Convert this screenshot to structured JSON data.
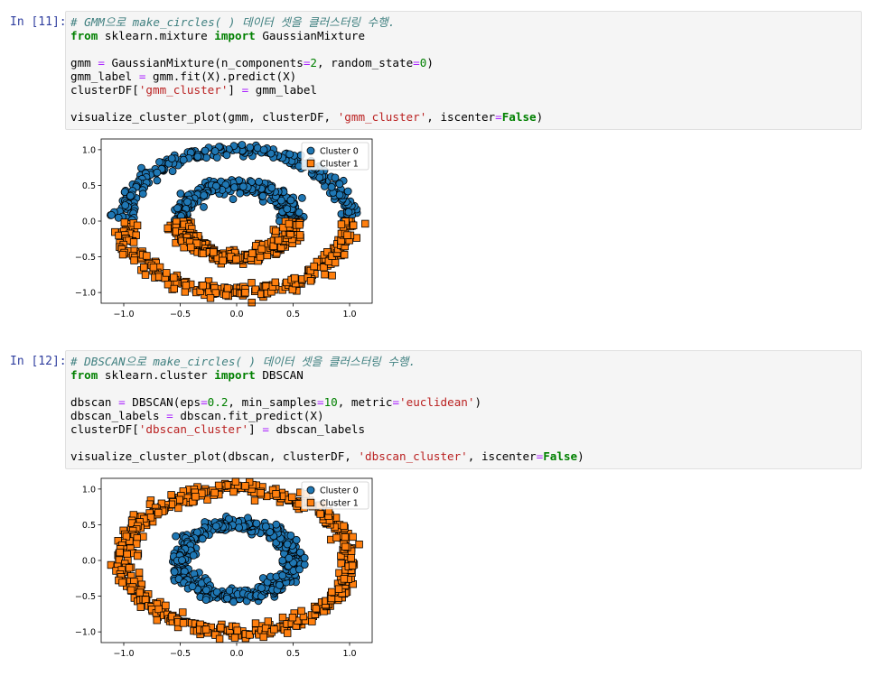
{
  "cells": [
    {
      "prompt": "In [11]:",
      "code": [
        [
          {
            "t": "# GMM으로 make_circles( ) 데이터 셋을 클러스터링 수행.",
            "c": "comment"
          }
        ],
        [
          {
            "t": "from",
            "c": "kw"
          },
          {
            "t": " sklearn.mixture ",
            "c": ""
          },
          {
            "t": "import",
            "c": "kw"
          },
          {
            "t": " GaussianMixture",
            "c": ""
          }
        ],
        [],
        [
          {
            "t": "gmm ",
            "c": ""
          },
          {
            "t": "=",
            "c": "op"
          },
          {
            "t": " GaussianMixture(n_components",
            "c": ""
          },
          {
            "t": "=",
            "c": "op"
          },
          {
            "t": "2",
            "c": "num"
          },
          {
            "t": ", random_state",
            "c": ""
          },
          {
            "t": "=",
            "c": "op"
          },
          {
            "t": "0",
            "c": "num"
          },
          {
            "t": ")",
            "c": ""
          }
        ],
        [
          {
            "t": "gmm_label ",
            "c": ""
          },
          {
            "t": "=",
            "c": "op"
          },
          {
            "t": " gmm.fit(X).predict(X)",
            "c": ""
          }
        ],
        [
          {
            "t": "clusterDF[",
            "c": ""
          },
          {
            "t": "'gmm_cluster'",
            "c": "str"
          },
          {
            "t": "] ",
            "c": ""
          },
          {
            "t": "=",
            "c": "op"
          },
          {
            "t": " gmm_label",
            "c": ""
          }
        ],
        [],
        [
          {
            "t": "visualize_cluster_plot(gmm, clusterDF, ",
            "c": ""
          },
          {
            "t": "'gmm_cluster'",
            "c": "str"
          },
          {
            "t": ", iscenter",
            "c": ""
          },
          {
            "t": "=",
            "c": "op"
          },
          {
            "t": "False",
            "c": "kw"
          },
          {
            "t": ")",
            "c": ""
          }
        ]
      ]
    },
    {
      "prompt": "In [12]:",
      "code": [
        [
          {
            "t": "# DBSCAN으로 make_circles( ) 데이터 셋을 클러스터링 수행.",
            "c": "comment"
          }
        ],
        [
          {
            "t": "from",
            "c": "kw"
          },
          {
            "t": " sklearn.cluster ",
            "c": ""
          },
          {
            "t": "import",
            "c": "kw"
          },
          {
            "t": " DBSCAN",
            "c": ""
          }
        ],
        [],
        [
          {
            "t": "dbscan ",
            "c": ""
          },
          {
            "t": "=",
            "c": "op"
          },
          {
            "t": " DBSCAN(eps",
            "c": ""
          },
          {
            "t": "=",
            "c": "op"
          },
          {
            "t": "0.2",
            "c": "num"
          },
          {
            "t": ", min_samples",
            "c": ""
          },
          {
            "t": "=",
            "c": "op"
          },
          {
            "t": "10",
            "c": "num"
          },
          {
            "t": ", metric",
            "c": ""
          },
          {
            "t": "=",
            "c": "op"
          },
          {
            "t": "'euclidean'",
            "c": "str"
          },
          {
            "t": ")",
            "c": ""
          }
        ],
        [
          {
            "t": "dbscan_labels ",
            "c": ""
          },
          {
            "t": "=",
            "c": "op"
          },
          {
            "t": " dbscan.fit_predict(X)",
            "c": ""
          }
        ],
        [
          {
            "t": "clusterDF[",
            "c": ""
          },
          {
            "t": "'dbscan_cluster'",
            "c": "str"
          },
          {
            "t": "] ",
            "c": ""
          },
          {
            "t": "=",
            "c": "op"
          },
          {
            "t": " dbscan_labels",
            "c": ""
          }
        ],
        [],
        [
          {
            "t": "visualize_cluster_plot(dbscan, clusterDF, ",
            "c": ""
          },
          {
            "t": "'dbscan_cluster'",
            "c": "str"
          },
          {
            "t": ", iscenter",
            "c": ""
          },
          {
            "t": "=",
            "c": "op"
          },
          {
            "t": "False",
            "c": "kw"
          },
          {
            "t": ")",
            "c": ""
          }
        ]
      ]
    }
  ],
  "chart_data": [
    {
      "type": "scatter",
      "xlim": [
        -1.2,
        1.2
      ],
      "ylim": [
        -1.15,
        1.15
      ],
      "xticks": [
        "−1.0",
        "−0.5",
        "0.0",
        "0.5",
        "1.0"
      ],
      "yticks": [
        "1.0",
        "0.5",
        "0.0",
        "−0.5",
        "−1.0"
      ],
      "xtick_values": [
        -1.0,
        -0.5,
        0.0,
        0.5,
        1.0
      ],
      "ytick_values": [
        1.0,
        0.5,
        0.0,
        -0.5,
        -1.0
      ],
      "legend": {
        "placement": "top-right",
        "entries": [
          "Cluster 0",
          "Cluster 1"
        ]
      },
      "series": [
        {
          "name": "Cluster 0",
          "marker": "circle",
          "color": "#1f77b4",
          "rule": "y >= 0 (upper half of both rings)"
        },
        {
          "name": "Cluster 1",
          "marker": "square",
          "color": "#ff7f0e",
          "rule": "y < 0 (lower half of both rings)"
        }
      ],
      "rings": [
        {
          "radius": 1.0,
          "points": 500
        },
        {
          "radius": 0.5,
          "points": 500
        }
      ],
      "noise": 0.05
    },
    {
      "type": "scatter",
      "xlim": [
        -1.2,
        1.2
      ],
      "ylim": [
        -1.15,
        1.15
      ],
      "xticks": [
        "−1.0",
        "−0.5",
        "0.0",
        "0.5",
        "1.0"
      ],
      "yticks": [
        "1.0",
        "0.5",
        "0.0",
        "−0.5",
        "−1.0"
      ],
      "xtick_values": [
        -1.0,
        -0.5,
        0.0,
        0.5,
        1.0
      ],
      "ytick_values": [
        1.0,
        0.5,
        0.0,
        -0.5,
        -1.0
      ],
      "legend": {
        "placement": "top-right",
        "entries": [
          "Cluster 0",
          "Cluster 1"
        ]
      },
      "series": [
        {
          "name": "Cluster 0",
          "marker": "circle",
          "color": "#1f77b4",
          "rule": "inner ring (radius 0.5)"
        },
        {
          "name": "Cluster 1",
          "marker": "square",
          "color": "#ff7f0e",
          "rule": "outer ring (radius 1.0)"
        }
      ],
      "rings": [
        {
          "radius": 1.0,
          "points": 500
        },
        {
          "radius": 0.5,
          "points": 500
        }
      ],
      "noise": 0.05
    }
  ]
}
